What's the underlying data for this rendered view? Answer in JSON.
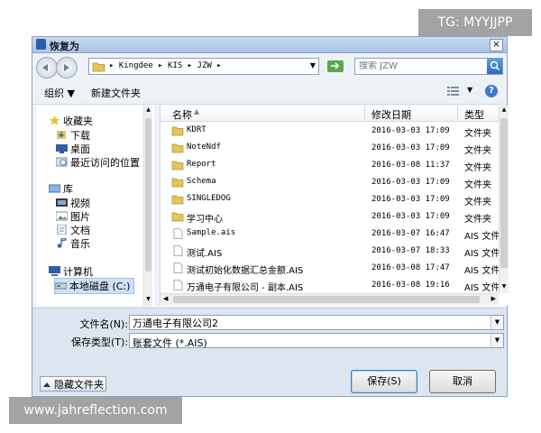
{
  "watermark_top": "TG: MYYJJPP",
  "watermark_bottom": "www.jahreflection.com",
  "window": {
    "title": "恢复为",
    "close": "×"
  },
  "address": {
    "crumbs": "▸ Kingdee ▸ KIS ▸ JZW ▸"
  },
  "search": {
    "placeholder": "搜索 JZW"
  },
  "toolbar": {
    "organize": "组织 ▼",
    "new_folder": "新建文件夹",
    "help": "?"
  },
  "nav": {
    "favorites": "收藏夹",
    "items_fav": [
      "下载",
      "桌面",
      "最近访问的位置"
    ],
    "library": "库",
    "items_lib": [
      "视频",
      "图片",
      "文档",
      "音乐"
    ],
    "computer": "计算机",
    "drive_c": "本地磁盘 (C:)"
  },
  "columns": {
    "name": "名称",
    "modified": "修改日期",
    "type": "类型"
  },
  "files": [
    {
      "name": "KDRT",
      "date": "2016-03-03 17:09",
      "type": "文件夹",
      "kind": "folder"
    },
    {
      "name": "NoteNdf",
      "date": "2016-03-03 17:09",
      "type": "文件夹",
      "kind": "folder"
    },
    {
      "name": "Report",
      "date": "2016-03-08 11:37",
      "type": "文件夹",
      "kind": "folder"
    },
    {
      "name": "Schema",
      "date": "2016-03-03 17:09",
      "type": "文件夹",
      "kind": "folder"
    },
    {
      "name": "SINGLEDOG",
      "date": "2016-03-03 17:09",
      "type": "文件夹",
      "kind": "folder"
    },
    {
      "name": "学习中心",
      "date": "2016-03-03 17:09",
      "type": "文件夹",
      "kind": "folder"
    },
    {
      "name": "Sample.ais",
      "date": "2016-03-07 16:47",
      "type": "AIS 文件",
      "kind": "file"
    },
    {
      "name": "测试.AIS",
      "date": "2016-03-07 18:33",
      "type": "AIS 文件",
      "kind": "file"
    },
    {
      "name": "测试初始化数据汇总金额.AIS",
      "date": "2016-03-08 17:47",
      "type": "AIS 文件",
      "kind": "file"
    },
    {
      "name": "万通电子有限公司 - 副本.AIS",
      "date": "2016-03-08 19:16",
      "type": "AIS 文件",
      "kind": "file"
    }
  ],
  "form": {
    "filename_label": "文件名(N):",
    "filename_value": "万通电子有限公司2",
    "filetype_label": "保存类型(T):",
    "filetype_value": "账套文件 (*.AIS)"
  },
  "footer": {
    "hide_folders": "隐藏文件夹",
    "save": "保存(S)",
    "cancel": "取消"
  },
  "colors": {
    "folder": "#e8c25a",
    "accent": "#3c7fb1"
  }
}
